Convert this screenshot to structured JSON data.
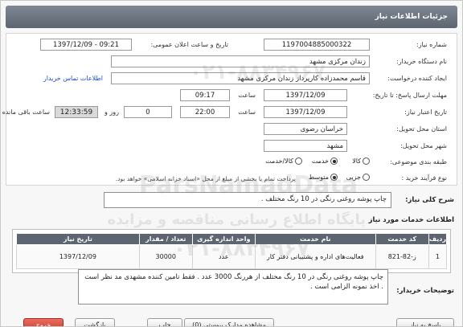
{
  "header": {
    "title": "جزئیات اطلاعات نیاز"
  },
  "form": {
    "need_number_label": "شماره نیاز:",
    "need_number": "1197004885000322",
    "announce_label": "تاریخ و ساعت اعلان عمومی:",
    "announce_value": "1397/12/09 - 09:21",
    "buyer_org_label": "نام دستگاه خریدار:",
    "buyer_org": "زندان مرکزی مشهد",
    "creator_label": "ایجاد کننده درخواست:",
    "creator": "قاسم محمدزاده کارپرداز زندان مرکزی مشهد",
    "contact_link": "اطلاعات تماس خریدار",
    "reply_deadline_label": "مهلت ارسال پاسخ: تا تاریخ:",
    "reply_date": "1397/12/09",
    "reply_time_label": "ساعت",
    "reply_time": "09:17",
    "validity_label": "تاریخ اعتبار نیاز:",
    "validity_date": "1397/12/09",
    "validity_time_label": "ساعت",
    "validity_time": "22:00",
    "days": "0",
    "days_label": "روز و",
    "remaining_time": "12:33:59",
    "remaining_label": "ساعت باقی مانده",
    "province_label": "استان محل تحویل:",
    "province": "خراسان رضوی",
    "city_label": "شهر محل تحویل:",
    "city": "مشهد",
    "category_label": "طبقه بندی موضوعی:",
    "category_options": [
      "کالا",
      "خدمت",
      "کالا/خدمت"
    ],
    "category_selected": "خدمت",
    "process_label": "نوع فرآیند خرید :",
    "process_options": [
      "جزیی",
      "متوسط"
    ],
    "process_selected": "متوسط",
    "process_note": "پرداخت تمام یا بخشی از مبلغ از محل «اسناد خزانه اسلامی» خواهد بود."
  },
  "summary": {
    "label": "شرح کلی نیاز:",
    "value": "چاپ پوشه روغنی رنگی در 10 رنگ مختلف ."
  },
  "services": {
    "section_title": "اطلاعات خدمات مورد نیاز",
    "columns": [
      "ردیف",
      "کد خدمت",
      "نام خدمت",
      "واحد اندازه گیری",
      "تعداد / مقدار",
      "تاریخ نیاز"
    ],
    "rows": [
      [
        "1",
        "ز-82-821",
        "فعالیت‌های اداره و پشتیبانی دفتر کار",
        "عدد",
        "30000",
        "1397/12/09"
      ]
    ]
  },
  "buyer_notes": {
    "label": "توضیحات خریدار:",
    "value": "چاپ پوشه روغنی رنگی در 10 رنگ مختلف از هررنگ 3000 عدد . فقط تامین کننده مشهدی مد نظر است . اخذ نمونه الزامی است ."
  },
  "buttons": {
    "reply": "پاسخ به نیاز",
    "view_docs": "مشاهده مدارک پیوستی (0)",
    "print": "چاپ",
    "back": "بازگشت",
    "exit": "خروج"
  },
  "watermark": {
    "top": "۰۲۱-۸۸۳۴۹۶۷",
    "brand": "ParsNamadData",
    "caption": "پایگاه اطلاع رسانی مناقصه و مزایده",
    "phone": "۰۲۱-۸۸۳۴۹۶۷"
  }
}
